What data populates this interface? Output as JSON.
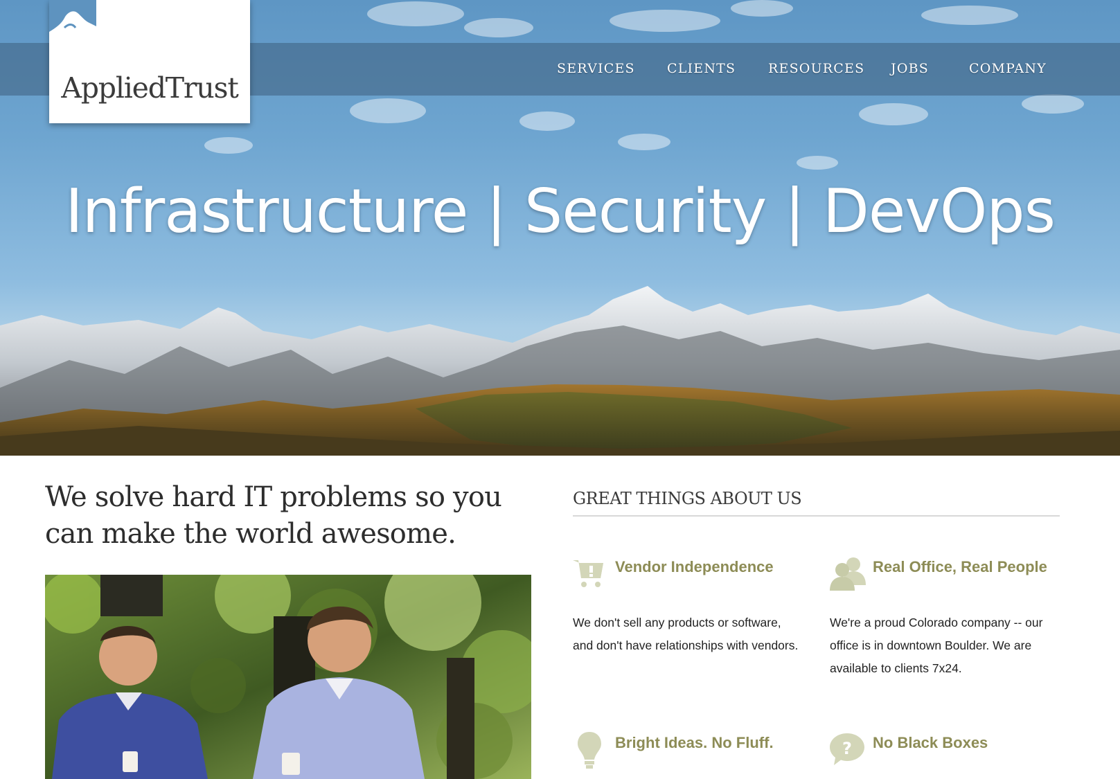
{
  "brand": {
    "name": "AppliedTrust"
  },
  "nav": {
    "items": [
      {
        "label": "SERVICES"
      },
      {
        "label": "CLIENTS"
      },
      {
        "label": "RESOURCES"
      },
      {
        "label": "JOBS"
      },
      {
        "label": "COMPANY"
      }
    ]
  },
  "hero": {
    "tagline": "Infrastructure | Security | DevOps"
  },
  "main": {
    "headline": "We solve hard IT problems so you can make the world awesome."
  },
  "features": {
    "section_title": "GREAT THINGS ABOUT US",
    "items": [
      {
        "icon": "shopping-cart-icon",
        "title": "Vendor Independence",
        "text": "We don't sell any products or software, and don't have relationships with vendors."
      },
      {
        "icon": "people-icon",
        "title": "Real Office, Real People",
        "text": "We're a proud Colorado company -- our office is in downtown Boulder. We are available to clients 7x24."
      },
      {
        "icon": "lightbulb-icon",
        "title": "Bright Ideas. No Fluff.",
        "text": ""
      },
      {
        "icon": "question-bubble-icon",
        "title": "No Black Boxes",
        "text": ""
      }
    ]
  },
  "colors": {
    "accent_olive": "#8d8c56",
    "icon_tint": "#d3d6b8",
    "nav_bar": "#3e5f7d",
    "sky": "#6ea5d0"
  }
}
